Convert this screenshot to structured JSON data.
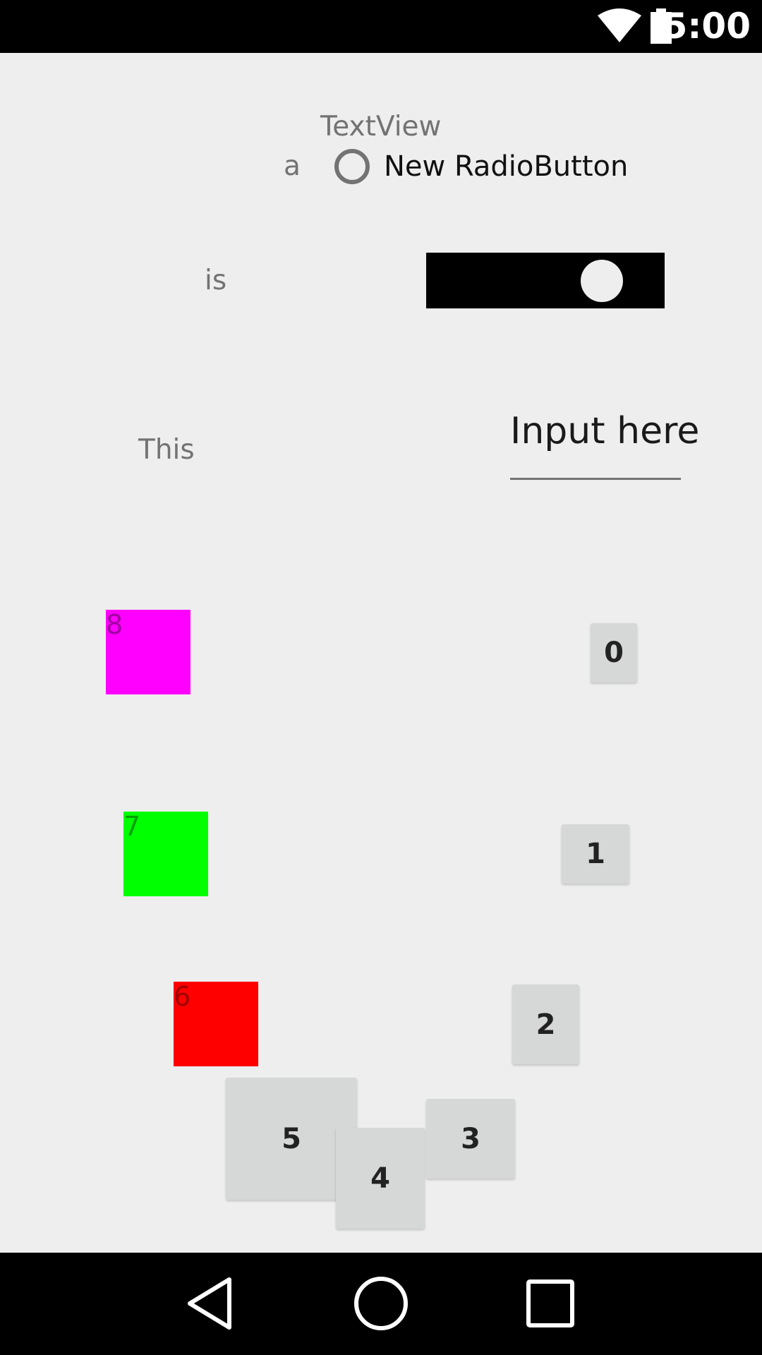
{
  "status_bar": {
    "time": "5:00",
    "icons": [
      "wifi-icon",
      "battery-icon"
    ]
  },
  "main": {
    "textview_label": "TextView",
    "word_a": "a",
    "word_is": "is",
    "word_this": "This",
    "radio_button": {
      "label": "New RadioButton",
      "checked": false
    },
    "switch": {
      "state": "on"
    },
    "input": {
      "placeholder": "Input here"
    },
    "color_boxes": [
      {
        "label": "8",
        "color": "#ff00ff",
        "text_color": "#a000a0"
      },
      {
        "label": "7",
        "color": "#00ff00",
        "text_color": "#00a000"
      },
      {
        "label": "6",
        "color": "#ff0000",
        "text_color": "#a00000"
      }
    ],
    "buttons": [
      "0",
      "1",
      "2",
      "3",
      "4",
      "5"
    ]
  },
  "nav_bar": {
    "icons": [
      "back-icon",
      "home-icon",
      "recents-icon"
    ]
  }
}
